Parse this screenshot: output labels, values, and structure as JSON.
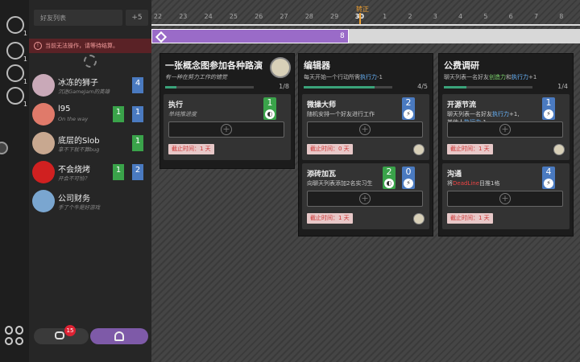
{
  "rail": {
    "icons": [
      {
        "name": "friends-icon",
        "sub": "1"
      },
      {
        "name": "message-icon",
        "sub": "1"
      },
      {
        "name": "profile-icon",
        "sub": "1"
      },
      {
        "name": "clock-icon",
        "sub": "1"
      }
    ]
  },
  "panel": {
    "search_placeholder": "好友列表",
    "plus_label": "+5",
    "warning": "当前无法操作，请等待结算。",
    "friends": [
      {
        "name": "冰冻的狮子",
        "status": "沉迷GameJam的英雄",
        "badges": [
          {
            "color": "blue",
            "value": "4"
          }
        ],
        "avatar_color": "#c9a9b8"
      },
      {
        "name": "l95",
        "status": "On the way",
        "badges": [
          {
            "color": "green",
            "value": "1"
          },
          {
            "color": "blue",
            "value": "1"
          }
        ],
        "avatar_color": "#e07a6a"
      },
      {
        "name": "底层的Slob",
        "status": "拿不下就不算bug",
        "badges": [
          {
            "color": "green",
            "value": "1"
          }
        ],
        "avatar_color": "#c8a890"
      },
      {
        "name": "不会烧烤",
        "status": "开会不可怕？",
        "badges": [
          {
            "color": "green",
            "value": "1"
          },
          {
            "color": "blue",
            "value": "2"
          }
        ],
        "avatar_color": "#d02020"
      },
      {
        "name": "公司财务",
        "status": "手了个牛是好游戏",
        "badges": [],
        "avatar_color": "#7aa6d0"
      }
    ],
    "chat_count": "15"
  },
  "timeline": {
    "days": [
      "22",
      "23",
      "24",
      "25",
      "26",
      "27",
      "28",
      "29",
      "30",
      "1",
      "2",
      "3",
      "4",
      "5",
      "6",
      "7",
      "8"
    ],
    "today": "30",
    "today_label": "转正",
    "progress_value": "8",
    "progress_fraction": 0.46,
    "progress_color": "#9a6bc8"
  },
  "columns": [
    {
      "title": "一张概念图参加各种路演",
      "subtitle": "有一种在努力工作的错觉",
      "count": "1/8",
      "fraction": 0.125,
      "tasks": [
        {
          "name": "执行",
          "desc": "单纯推进度",
          "stats": [
            {
              "color": "green",
              "value": "1",
              "icon": "palette-icon"
            }
          ],
          "deadline": "截止时间：1 天",
          "owner": false
        }
      ]
    },
    {
      "title": "编辑器",
      "subtitle_pre": "每天开始一个行动所需",
      "subtitle_hi": "执行力",
      "subtitle_post": "-1",
      "count": "4/5",
      "fraction": 0.8,
      "tasks": [
        {
          "name": "微操大师",
          "desc": "随机安排一个好友进行工作",
          "stats": [
            {
              "color": "blue",
              "value": "2",
              "icon": "bolt-icon"
            }
          ],
          "deadline": "截止时间：0 天",
          "owner": true
        },
        {
          "name": "添砖加瓦",
          "desc": "向聊天列表添加2名实习生",
          "stats": [
            {
              "color": "green",
              "value": "2",
              "icon": "palette-icon"
            },
            {
              "color": "blue",
              "value": "0",
              "icon": "bolt-icon"
            }
          ],
          "deadline": "截止时间：1 天",
          "owner": true
        }
      ]
    },
    {
      "title": "公费调研",
      "subtitle_pre": "聊天列表一名好友",
      "subtitle_g": "创造力",
      "subtitle_mid": "和",
      "subtitle_hi": "执行力",
      "subtitle_post": "+1",
      "count": "1/4",
      "fraction": 0.25,
      "tasks": [
        {
          "name": "开源节流",
          "desc_pre": "聊天列表一名好友",
          "desc_hi": "执行力",
          "desc_post": "+1,",
          "desc2_pre": "其他人",
          "desc2_hi": "执行力",
          "desc2_post": "-1",
          "stats": [
            {
              "color": "blue",
              "value": "1",
              "icon": "bolt-icon"
            }
          ],
          "deadline": "截止时间：1 天",
          "owner": true
        },
        {
          "name": "沟通",
          "desc_pre": "将",
          "desc_dl": "DeadLine",
          "desc_post": "目推1格",
          "stats": [
            {
              "color": "blue",
              "value": "4",
              "icon": "bolt-icon"
            }
          ],
          "deadline": "截止时间：1 天",
          "owner": false
        }
      ]
    }
  ]
}
